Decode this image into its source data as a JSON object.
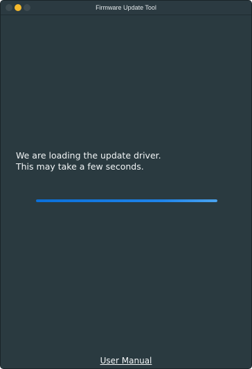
{
  "window": {
    "title": "Firmware Update Tool",
    "colors": {
      "background": "#2a3a40",
      "text": "#f2f5f6",
      "accent": "#1f84ea",
      "minimize": "#f5b92c"
    }
  },
  "titlebar": {
    "buttons": [
      {
        "name": "close",
        "icon": "close-dot-icon"
      },
      {
        "name": "minimize",
        "icon": "minimize-dot-icon"
      },
      {
        "name": "zoom",
        "icon": "zoom-dot-icon"
      }
    ]
  },
  "main": {
    "message_line1": "We are loading the update driver.",
    "message_line2": "This may take a few seconds.",
    "progress": {
      "value_percent": 100
    }
  },
  "footer": {
    "link_label": "User Manual"
  }
}
